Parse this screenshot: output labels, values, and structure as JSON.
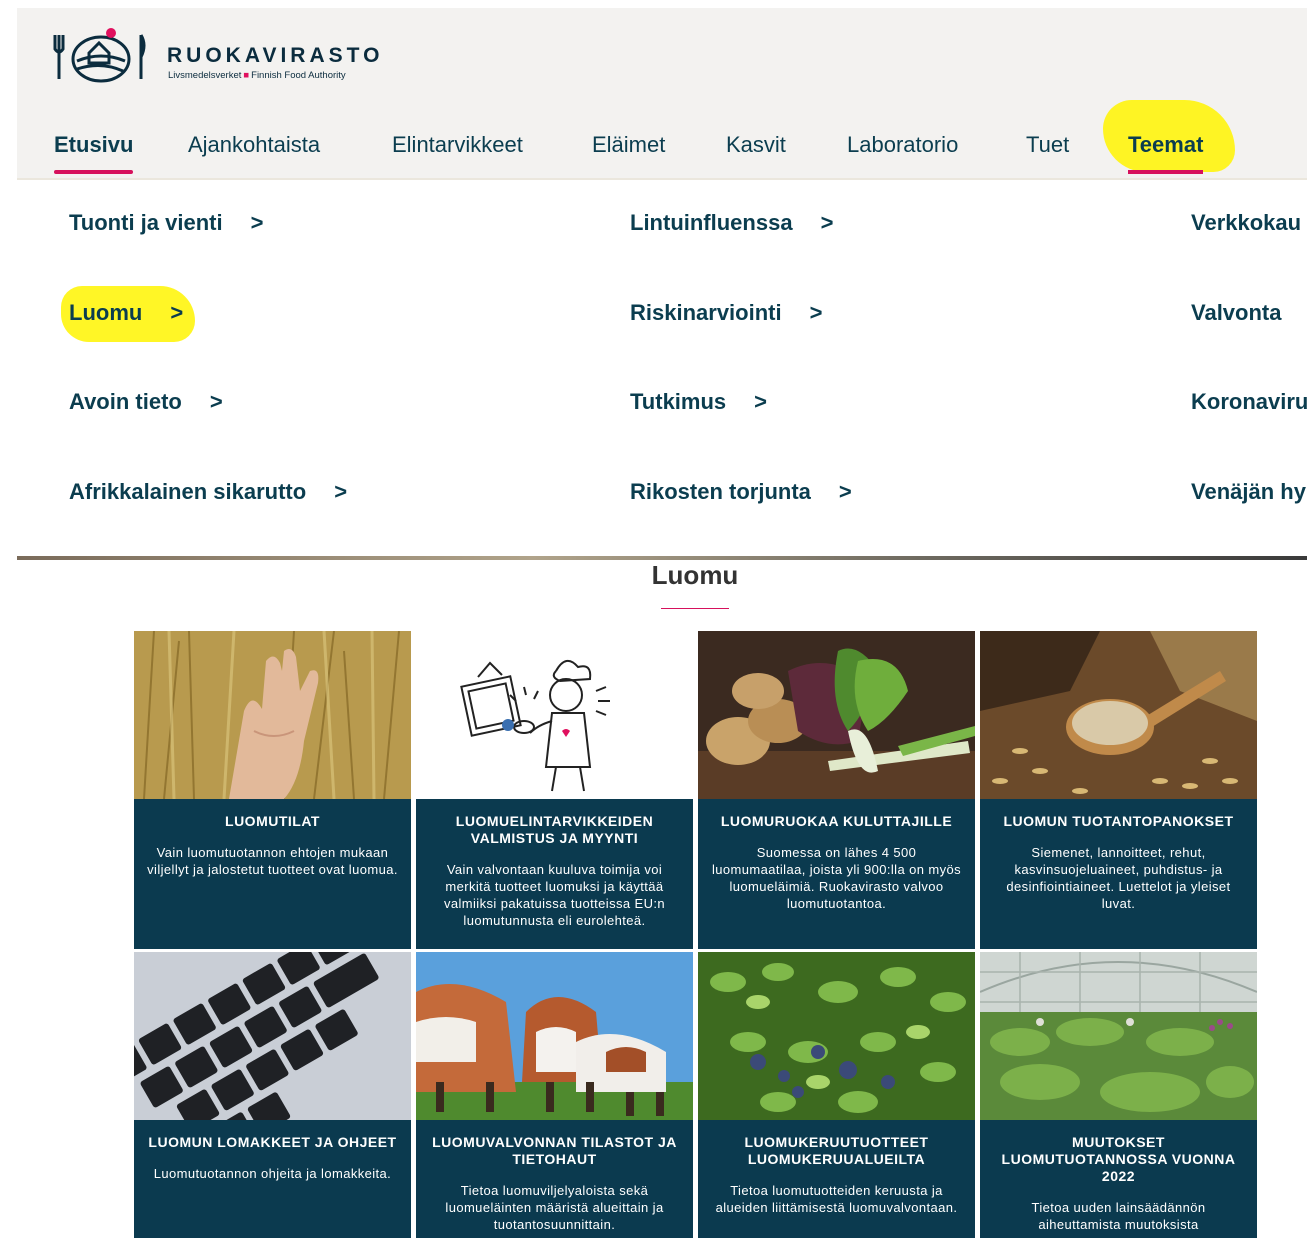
{
  "brand": {
    "name": "RUOKAVIRASTO",
    "sub_left": "Livsmedelsverket",
    "sub_right": "Finnish Food Authority"
  },
  "nav": {
    "items": [
      "Etusivu",
      "Ajankohtaista",
      "Elintarvikkeet",
      "Eläimet",
      "Kasvit",
      "Laboratorio",
      "Tuet",
      "Teemat"
    ],
    "active": "Etusivu"
  },
  "menu": {
    "col1": [
      "Tuonti ja vienti",
      "Luomu",
      "Avoin tieto",
      "Afrikkalainen sikarutto"
    ],
    "col2": [
      "Lintuinfluenssa",
      "Riskinarviointi",
      "Tutkimus",
      "Rikosten torjunta"
    ],
    "col3": [
      "Verkkokau",
      "Valvonta",
      "Koronaviru",
      "Venäjän hy"
    ],
    "chevron": ">"
  },
  "section": {
    "title": "Luomu"
  },
  "cards": [
    {
      "title": "LUOMUTILAT",
      "desc": "Vain luomutuotannon ehtojen mukaan viljellyt ja jalostetut tuotteet ovat luomua."
    },
    {
      "title": "LUOMUELINTARVIKKEIDEN VALMISTUS JA MYYNTI",
      "desc": "Vain valvontaan kuuluva toimija voi merkitä tuotteet luomuksi ja käyttää valmiiksi pakatuissa tuotteissa EU:n luomutunnusta eli eurolehteä."
    },
    {
      "title": "LUOMURUOKAA KULUTTAJILLE",
      "desc": "Suomessa on lähes 4 500 luomumaatilaa, joista yli 900:lla on myös luomueläimiä. Ruokavirasto valvoo luomutuotantoa."
    },
    {
      "title": "LUOMUN TUOTANTOPANOKSET",
      "desc": "Siemenet, lannoitteet, rehut, kasvinsuojeluaineet, puhdistus- ja desinfiointiaineet. Luettelot ja yleiset luvat."
    },
    {
      "title": "LUOMUN LOMAKKEET JA OHJEET",
      "desc": "Luomutuotannon ohjeita ja lomakkeita."
    },
    {
      "title": "LUOMUVALVONNAN TILASTOT JA TIETOHAUT",
      "desc": "Tietoa luomuviljelyaloista sekä luomueläinten määristä alueittain ja tuotantosuunnittain."
    },
    {
      "title": "LUOMUKERUUTUOTTEET LUOMUKERUUALUEILTA",
      "desc": "Tietoa luomutuotteiden keruusta ja alueiden liittämisestä luomuvalvontaan."
    },
    {
      "title": "MUUTOKSET LUOMUTUOTANNOSSA VUONNA 2022",
      "desc": "Tietoa uuden lainsäädännön aiheuttamista muutoksista"
    }
  ],
  "colors": {
    "card_bg": "#0b3a4f",
    "nav_text": "#0b3d4f",
    "accent": "#d6115c",
    "highlight": "#fff500"
  }
}
